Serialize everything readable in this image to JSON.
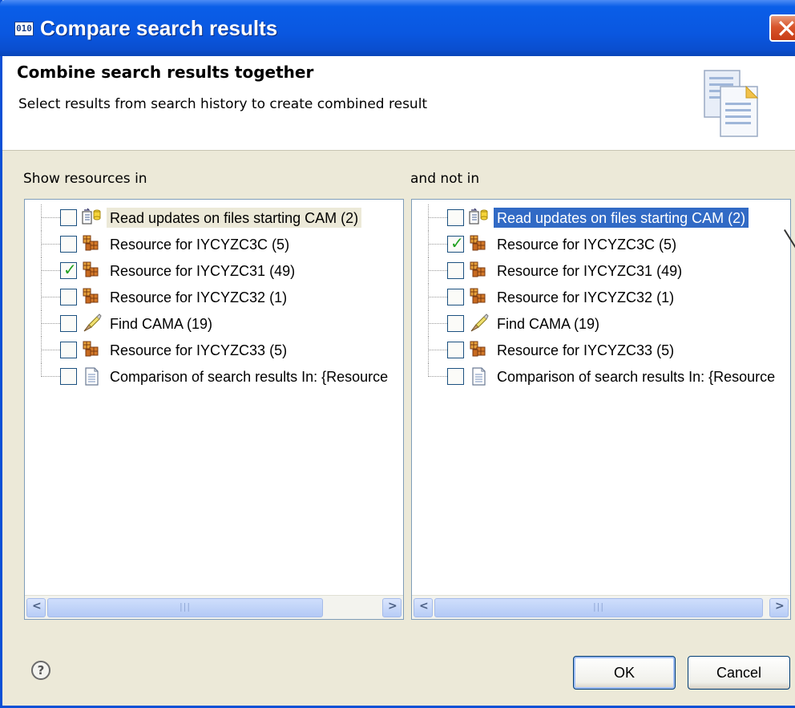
{
  "window": {
    "title": "Compare search results",
    "icon": "app-window-icon",
    "close_icon": "close-icon"
  },
  "header": {
    "title": "Combine search results together",
    "description": "Select results from search history to create combined result",
    "graphic": "documents-icon"
  },
  "left_panel": {
    "label": "Show resources in",
    "items": [
      {
        "label": "Read updates on files starting CAM (2)",
        "icon": "read-updates-icon",
        "checked": false,
        "highlight": "light"
      },
      {
        "label": "Resource for IYCYZC3C (5)",
        "icon": "resource-icon",
        "checked": false
      },
      {
        "label": "Resource for IYCYZC31 (49)",
        "icon": "resource-icon",
        "checked": true
      },
      {
        "label": "Resource for IYCYZC32 (1)",
        "icon": "resource-icon",
        "checked": false
      },
      {
        "label": "Find  CAMA (19)",
        "icon": "find-icon",
        "checked": false
      },
      {
        "label": "Resource for IYCYZC33 (5)",
        "icon": "resource-icon",
        "checked": false
      },
      {
        "label": "Comparison of search results In: {Resource",
        "icon": "document-icon",
        "checked": false
      }
    ]
  },
  "right_panel": {
    "label": "and not in",
    "items": [
      {
        "label": "Read updates on files starting CAM (2)",
        "icon": "read-updates-icon",
        "checked": false,
        "highlight": "selected"
      },
      {
        "label": "Resource for IYCYZC3C (5)",
        "icon": "resource-icon",
        "checked": true
      },
      {
        "label": "Resource for IYCYZC31 (49)",
        "icon": "resource-icon",
        "checked": false
      },
      {
        "label": "Resource for IYCYZC32 (1)",
        "icon": "resource-icon",
        "checked": false
      },
      {
        "label": "Find  CAMA (19)",
        "icon": "find-icon",
        "checked": false
      },
      {
        "label": "Resource for IYCYZC33 (5)",
        "icon": "resource-icon",
        "checked": false
      },
      {
        "label": "Comparison of search results In: {Resource",
        "icon": "document-icon",
        "checked": false
      }
    ]
  },
  "footer": {
    "help_icon": "help-icon",
    "ok_label": "OK",
    "cancel_label": "Cancel"
  },
  "colors": {
    "titlebar": "#0a57e0",
    "dialog_bg": "#ece9d8",
    "selection": "#316ac5",
    "check": "#21a121"
  }
}
